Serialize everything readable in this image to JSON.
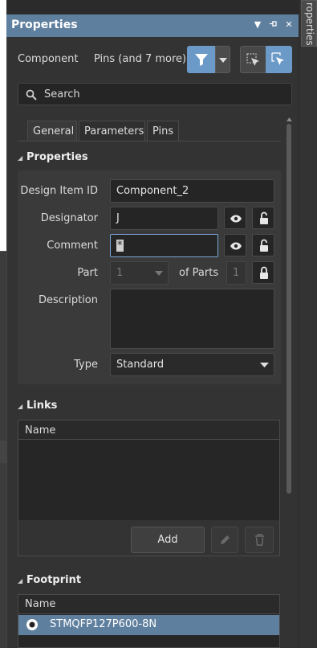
{
  "window": {
    "title": "Properties",
    "side_tab_label": "roperties"
  },
  "component_bar": {
    "kind_label": "Component",
    "filter_summary": "Pins (and 7 more)"
  },
  "search": {
    "placeholder": "Search"
  },
  "tabs": [
    {
      "label": "General",
      "active": true
    },
    {
      "label": "Parameters",
      "active": false
    },
    {
      "label": "Pins",
      "active": false
    }
  ],
  "properties": {
    "section_title": "Properties",
    "design_item_id_label": "Design Item ID",
    "design_item_id_value": "Component_2",
    "designator_label": "Designator",
    "designator_value": "J",
    "comment_label": "Comment",
    "comment_value": "*",
    "part_label": "Part",
    "part_value": "1",
    "of_parts_label": "of Parts",
    "of_parts_value": "1",
    "description_label": "Description",
    "description_value": "",
    "type_label": "Type",
    "type_value": "Standard"
  },
  "links": {
    "section_title": "Links",
    "column_name": "Name",
    "add_label": "Add"
  },
  "footprint": {
    "section_title": "Footprint",
    "column_name": "Name",
    "rows": [
      {
        "name": "STMQFP127P600-8N",
        "selected": true
      }
    ]
  },
  "colors": {
    "accent": "#5f7f9e",
    "button_active": "#6b9ac8",
    "panel_bg": "#333333",
    "field_bg": "#252525"
  },
  "icons": {
    "filter": "filter-icon",
    "select_a": "select-inside-icon",
    "select_b": "select-touching-icon",
    "visible": "eye-icon",
    "lock": "lock-icon"
  }
}
